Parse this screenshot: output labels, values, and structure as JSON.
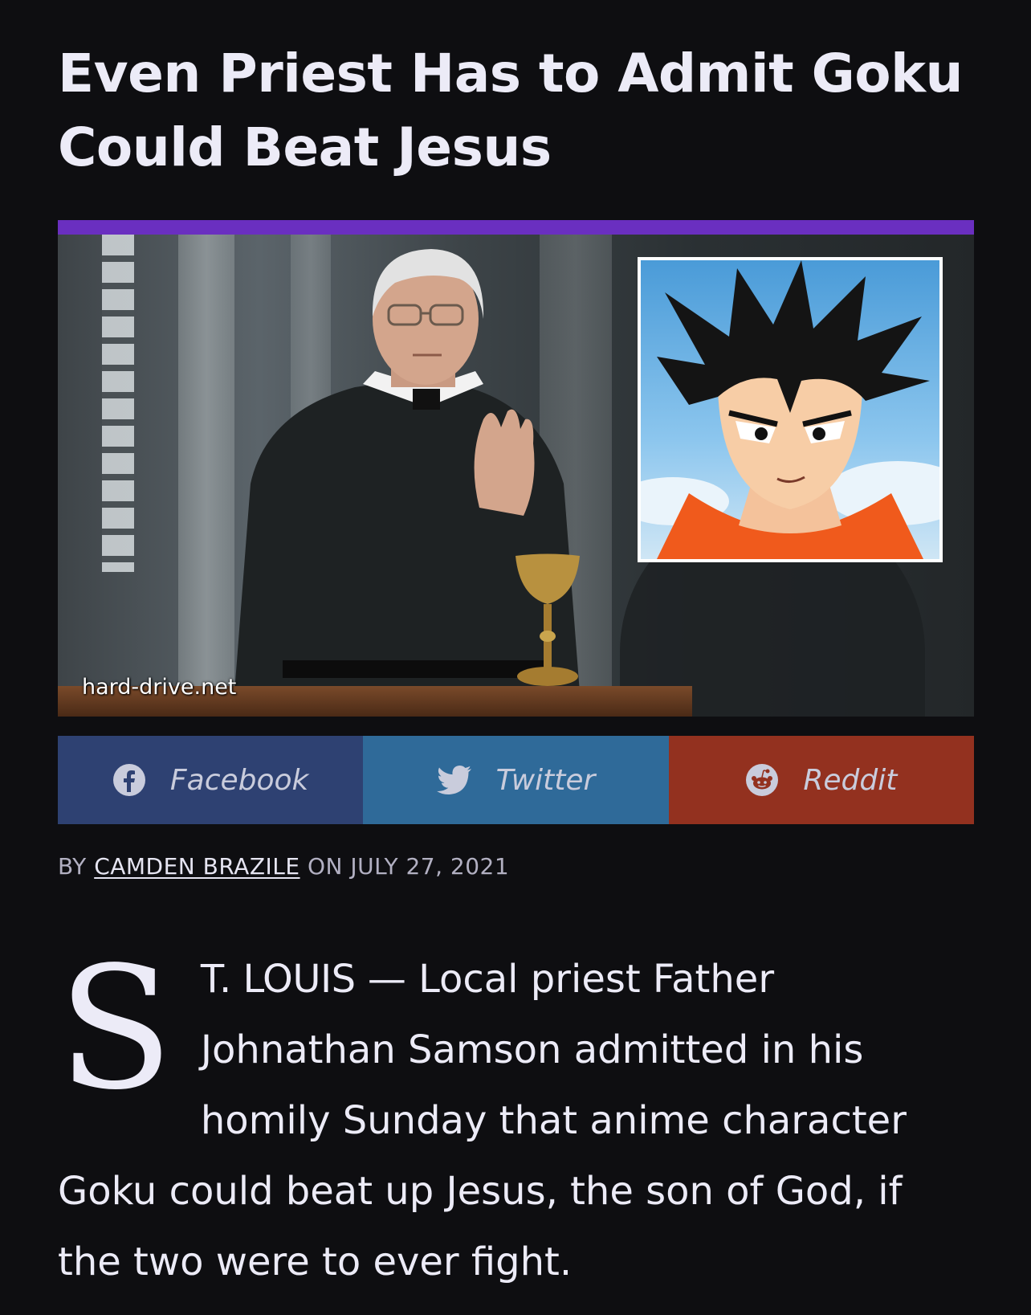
{
  "article": {
    "headline": "Even Priest Has to Admit Goku Could Beat Jesus",
    "image_watermark": "hard-drive.net",
    "byline": {
      "prefix": "BY",
      "author": "CAMDEN BRAZILE",
      "middle": "ON",
      "date": "JULY 27, 2021"
    },
    "body": {
      "dropcap": "S",
      "dateline": "T. LOUIS",
      "dash": " — ",
      "text": "Local priest Father Johnathan Samson admitted in his homily Sunday that anime character Goku could beat up Jesus, the son of God, if the two were to ever fight."
    }
  },
  "share": {
    "facebook": {
      "label": "Facebook",
      "icon": "facebook-icon",
      "color": "#2e4172"
    },
    "twitter": {
      "label": "Twitter",
      "icon": "twitter-icon",
      "color": "#2f6a99"
    },
    "reddit": {
      "label": "Reddit",
      "icon": "reddit-icon",
      "color": "#93311f"
    }
  },
  "theme": {
    "background": "#0e0e11",
    "accent": "#6a2fc0",
    "text": "#ecebf7"
  }
}
